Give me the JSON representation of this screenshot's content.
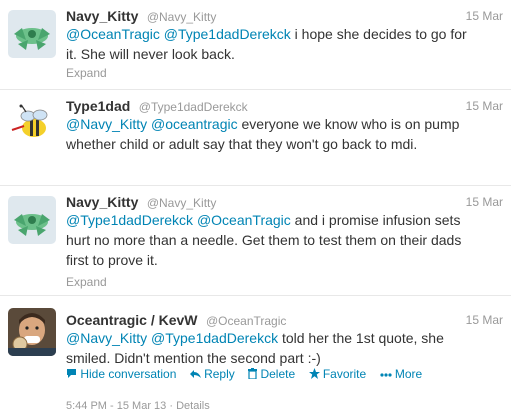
{
  "tweets": [
    {
      "fullname": "Navy_Kitty",
      "username": "@Navy_Kitty",
      "time": "15 Mar",
      "text_parts": [
        "@OceanTragic",
        " ",
        "@Type1dadDerekck",
        " i hope she decides to go for it. She will never look back."
      ],
      "expand": "Expand"
    },
    {
      "fullname": "Type1dad",
      "username": "@Type1dadDerekck",
      "time": "15 Mar",
      "text_parts": [
        "@Navy_Kitty",
        " ",
        "@oceantragic",
        " everyone we know who is on pump whether child or adult say that they won't go back to mdi."
      ]
    },
    {
      "fullname": "Navy_Kitty",
      "username": "@Navy_Kitty",
      "time": "15 Mar",
      "text_parts": [
        "@Type1dadDerekck",
        " ",
        "@OceanTragic",
        " and i promise infusion sets hurt no more than a needle. Get them to test them on their dads first to prove it."
      ],
      "expand": "Expand"
    },
    {
      "fullname": "Oceantragic / KevW",
      "username": "@OceanTragic",
      "time": "15 Mar",
      "text_parts": [
        "@Navy_Kitty",
        " ",
        "@Type1dadDerekck",
        " told her the 1st quote, she smiled. Didn't mention the second part :-)"
      ]
    }
  ],
  "actions": {
    "hide": "Hide conversation",
    "reply": "Reply",
    "delete": "Delete",
    "favorite": "Favorite",
    "more": "More"
  },
  "footer": {
    "timestamp": "5:44 PM - 15 Mar 13",
    "separator": "·",
    "details": "Details"
  },
  "colors": {
    "link": "#0084b4",
    "muted": "#999999",
    "text": "#333333"
  }
}
